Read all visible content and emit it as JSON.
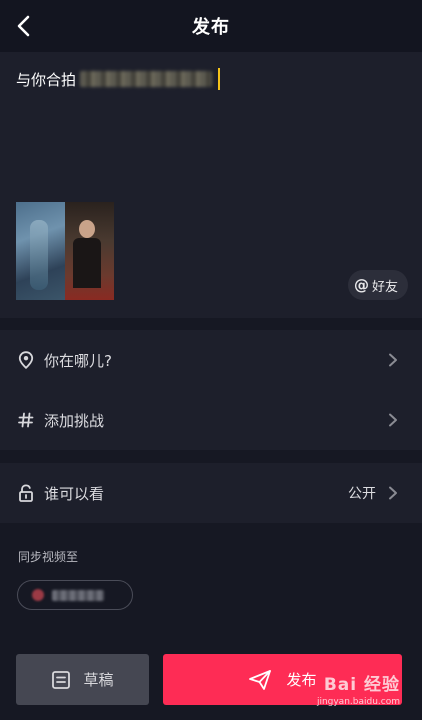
{
  "header": {
    "title": "发布"
  },
  "compose": {
    "caption_prefix": "与你合拍",
    "friends_button": {
      "symbol": "@",
      "label": "好友"
    }
  },
  "options": {
    "location": {
      "label": "你在哪儿?"
    },
    "challenge": {
      "label": "添加挑战"
    },
    "visibility": {
      "label": "谁可以看",
      "value": "公开"
    }
  },
  "sync": {
    "title": "同步视频至"
  },
  "actions": {
    "draft_label": "草稿",
    "publish_label": "发布"
  },
  "watermark": {
    "logo": "Bai 经验",
    "sub": "jingyan.baidu.com"
  },
  "colors": {
    "accent": "#fe2c55",
    "background": "#161823",
    "panel": "#1d1f2b",
    "cursor": "#f4c21a"
  }
}
